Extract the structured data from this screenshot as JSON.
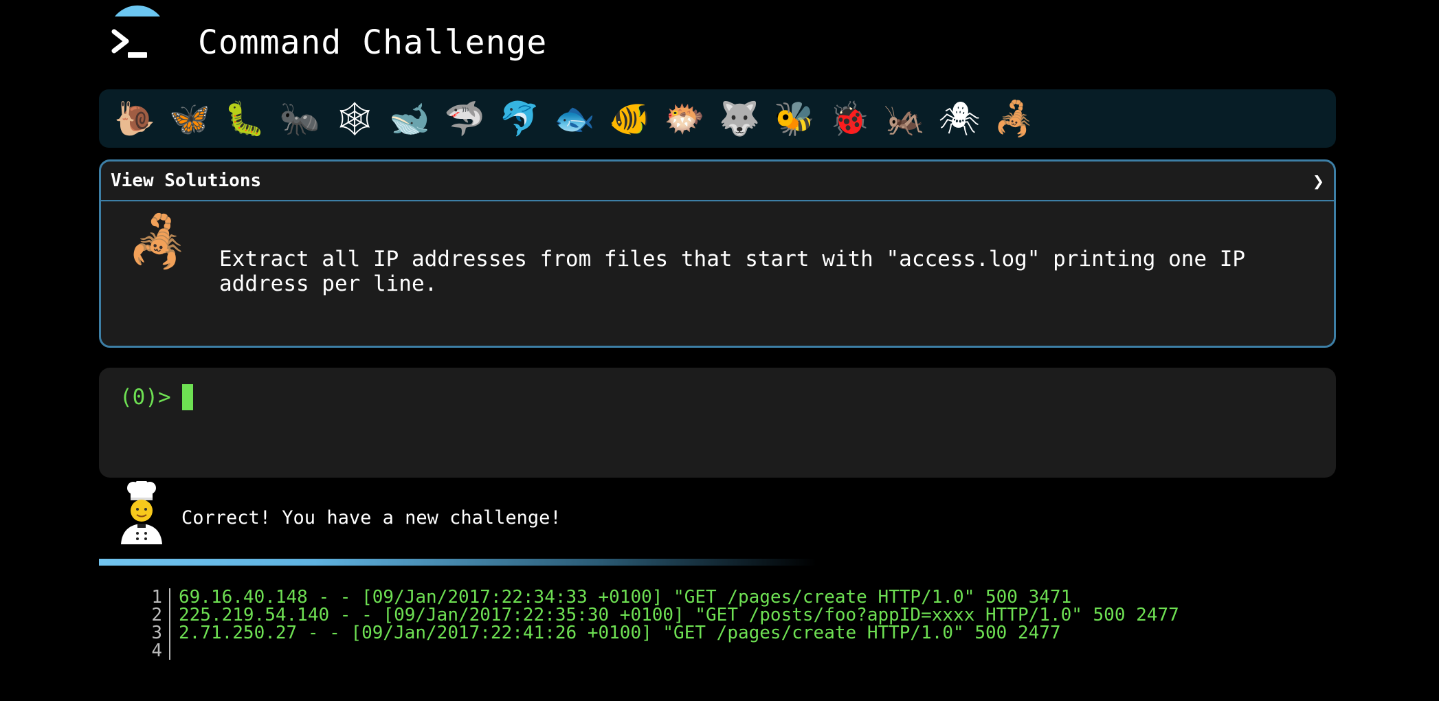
{
  "header": {
    "title": "Command Challenge"
  },
  "badges": [
    {
      "name": "snail-icon",
      "glyph": "🐌"
    },
    {
      "name": "butterfly-icon",
      "glyph": "🦋"
    },
    {
      "name": "caterpillar-icon",
      "glyph": "🐛"
    },
    {
      "name": "ant-icon",
      "glyph": "🐜"
    },
    {
      "name": "spider-web-icon",
      "glyph": "🕸"
    },
    {
      "name": "whale-icon",
      "glyph": "🐋"
    },
    {
      "name": "shark-icon",
      "glyph": "🦈"
    },
    {
      "name": "dolphin-icon",
      "glyph": "🐬"
    },
    {
      "name": "fish-icon",
      "glyph": "🐟"
    },
    {
      "name": "tropical-fish-icon",
      "glyph": "🐠"
    },
    {
      "name": "blowfish-icon",
      "glyph": "🐡"
    },
    {
      "name": "wolf-icon",
      "glyph": "🐺"
    },
    {
      "name": "bee-icon",
      "glyph": "🐝"
    },
    {
      "name": "ladybug-icon",
      "glyph": "🐞"
    },
    {
      "name": "cricket-icon",
      "glyph": "🦗"
    },
    {
      "name": "spider-icon",
      "glyph": "🕷"
    },
    {
      "name": "scorpion-icon",
      "glyph": "🦂"
    }
  ],
  "solutions": {
    "label": "View Solutions",
    "chevron": "❯",
    "challenge_icon": "🦂",
    "challenge_text": "Extract all IP addresses from files that start with \"access.log\" printing one IP address per line."
  },
  "terminal": {
    "prompt": "(0)>"
  },
  "feedback": {
    "message": "Correct! You have a new challenge!"
  },
  "progress": 0.58,
  "output": {
    "lines": [
      {
        "n": "1",
        "text": "69.16.40.148 - - [09/Jan/2017:22:34:33 +0100] \"GET /pages/create HTTP/1.0\" 500 3471"
      },
      {
        "n": "2",
        "text": "225.219.54.140 - - [09/Jan/2017:22:35:30 +0100] \"GET /posts/foo?appID=xxxx HTTP/1.0\" 500 2477"
      },
      {
        "n": "3",
        "text": "2.71.250.27 - - [09/Jan/2017:22:41:26 +0100] \"GET /pages/create HTTP/1.0\" 500 2477"
      },
      {
        "n": "4",
        "text": ""
      }
    ]
  }
}
